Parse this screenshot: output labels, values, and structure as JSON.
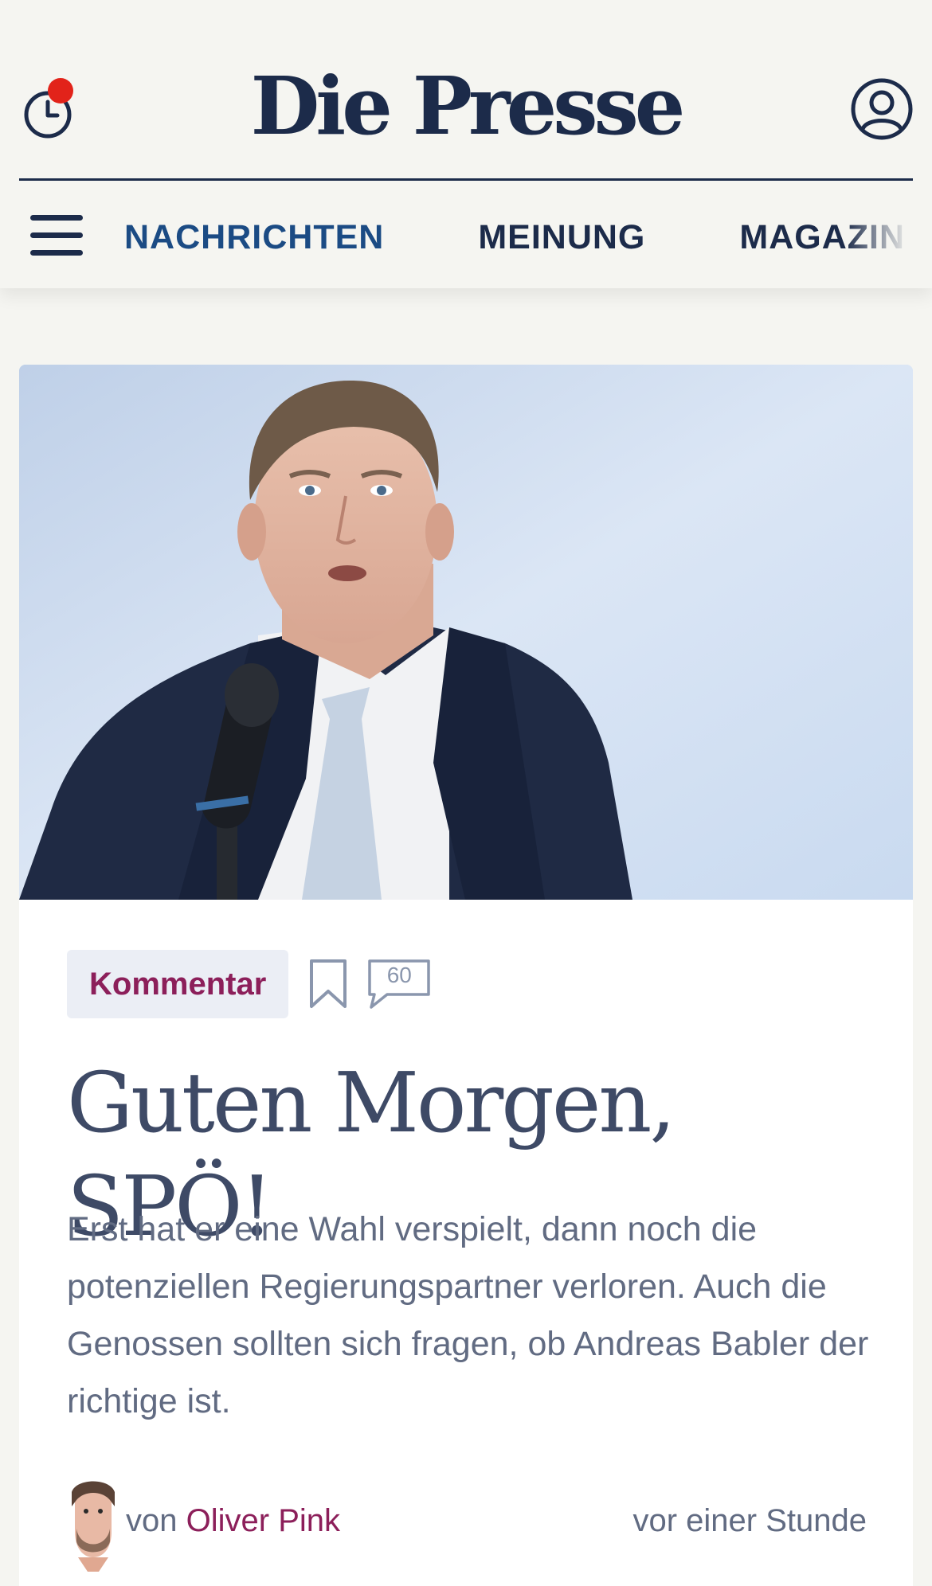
{
  "header": {
    "logo": "Die Presse",
    "history_icon": "history-clock-icon",
    "account_icon": "user-account-icon",
    "menu_icon": "hamburger-menu-icon"
  },
  "nav": {
    "items": [
      {
        "label": "NACHRICHTEN",
        "active": true
      },
      {
        "label": "MEINUNG",
        "active": false
      },
      {
        "label": "MAGAZIN",
        "active": false
      }
    ]
  },
  "article": {
    "category": "Kommentar",
    "bookmark_icon": "bookmark-icon",
    "comments_icon": "comment-bubble-icon",
    "comments_count": "60",
    "headline": "Guten Morgen, SPÖ!",
    "lede": "Erst hat er eine Wahl verspielt, dann noch die potenziellen Regierungspartner verloren. Auch die Genossen sollten sich fragen, ob Andreas Babler der richtige ist.",
    "byline_prefix": "von",
    "author": "Oliver Pink",
    "timestamp": "vor einer Stunde"
  },
  "colors": {
    "brand_navy": "#1c2b4a",
    "nav_active": "#1b4b84",
    "accent_magenta": "#8c1f5a",
    "notification_dot": "#e2231a",
    "page_bg": "#f5f5f1"
  }
}
